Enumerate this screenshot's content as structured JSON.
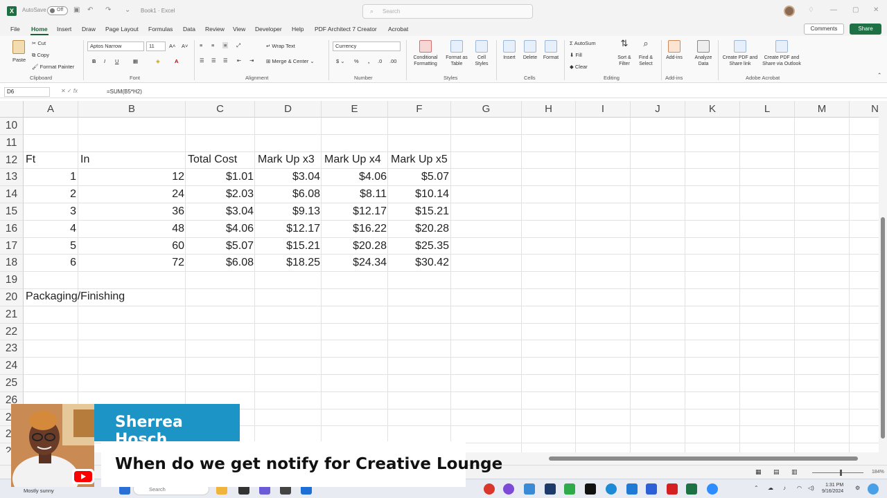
{
  "titlebar": {
    "autosave_label": "AutoSave",
    "autosave_state": "Off",
    "doc_title": "Book1 · Excel",
    "search_placeholder": "Search"
  },
  "tabs": [
    "File",
    "Home",
    "Insert",
    "Draw",
    "Page Layout",
    "Formulas",
    "Data",
    "Review",
    "View",
    "Developer",
    "Help",
    "PDF Architect 7 Creator",
    "Acrobat"
  ],
  "active_tab": "Home",
  "comments_label": "Comments",
  "share_label": "Share",
  "ribbon": {
    "clipboard": {
      "paste": "Paste",
      "cut": "Cut",
      "copy": "Copy",
      "format_painter": "Format Painter",
      "label": "Clipboard"
    },
    "font": {
      "name": "Aptos Narrow",
      "size": "11",
      "label": "Font"
    },
    "alignment": {
      "wrap": "Wrap Text",
      "merge": "Merge & Center",
      "label": "Alignment"
    },
    "number": {
      "format": "Currency",
      "label": "Number"
    },
    "styles": {
      "cond": "Conditional Formatting",
      "table": "Format as Table",
      "cell": "Cell Styles",
      "label": "Styles"
    },
    "cells": {
      "insert": "Insert",
      "delete": "Delete",
      "format": "Format",
      "label": "Cells"
    },
    "editing": {
      "autosum": "AutoSum",
      "fill": "Fill",
      "clear": "Clear",
      "sort": "Sort & Filter",
      "find": "Find & Select",
      "label": "Editing"
    },
    "addins": {
      "addins": "Add-ins",
      "label": "Add-ins"
    },
    "analyze": {
      "label": "Analyze Data"
    },
    "acrobat": {
      "create_pdf": "Create PDF and Share link",
      "create_pdf_outlook": "Create PDF and Share via Outlook",
      "label": "Adobe Acrobat"
    }
  },
  "formula_bar": {
    "name_box": "D6",
    "formula": "=SUM(B5*H2)"
  },
  "columns": [
    "A",
    "B",
    "C",
    "D",
    "E",
    "F",
    "G",
    "H",
    "I",
    "J",
    "K",
    "L",
    "M",
    "N"
  ],
  "rows": [
    "10",
    "11",
    "12",
    "13",
    "14",
    "15",
    "16",
    "17",
    "18",
    "19",
    "20",
    "21",
    "22",
    "23",
    "24",
    "25",
    "26",
    "27",
    "28",
    "29"
  ],
  "sheet": {
    "headers": {
      "a": "Ft",
      "b": "In",
      "c": "Total Cost",
      "d": "Mark Up x3",
      "e": "Mark Up x4",
      "f": "Mark Up x5"
    },
    "data": [
      {
        "ft": "1",
        "in": "12",
        "cost": "$1.01",
        "x3": "$3.04",
        "x4": "$4.06",
        "x5": "$5.07"
      },
      {
        "ft": "2",
        "in": "24",
        "cost": "$2.03",
        "x3": "$6.08",
        "x4": "$8.11",
        "x5": "$10.14"
      },
      {
        "ft": "3",
        "in": "36",
        "cost": "$3.04",
        "x3": "$9.13",
        "x4": "$12.17",
        "x5": "$15.21"
      },
      {
        "ft": "4",
        "in": "48",
        "cost": "$4.06",
        "x3": "$12.17",
        "x4": "$16.22",
        "x5": "$20.28"
      },
      {
        "ft": "5",
        "in": "60",
        "cost": "$5.07",
        "x3": "$15.21",
        "x4": "$20.28",
        "x5": "$25.35"
      },
      {
        "ft": "6",
        "in": "72",
        "cost": "$6.08",
        "x3": "$18.25",
        "x4": "$24.34",
        "x5": "$30.42"
      }
    ],
    "packaging": "Packaging/Finishing"
  },
  "status": {
    "zoom": "184%"
  },
  "taskbar": {
    "weather": "Mostly sunny",
    "search": "Search",
    "time": "1:31 PM",
    "date": "9/16/2024"
  },
  "overlay": {
    "name": "Sherrea Hosch",
    "comment": "When do we get notify for Creative Lounge"
  },
  "colors": {
    "excel_green": "#1e7145",
    "overlay_blue": "#1c94c6",
    "youtube_red": "#ff0000"
  }
}
